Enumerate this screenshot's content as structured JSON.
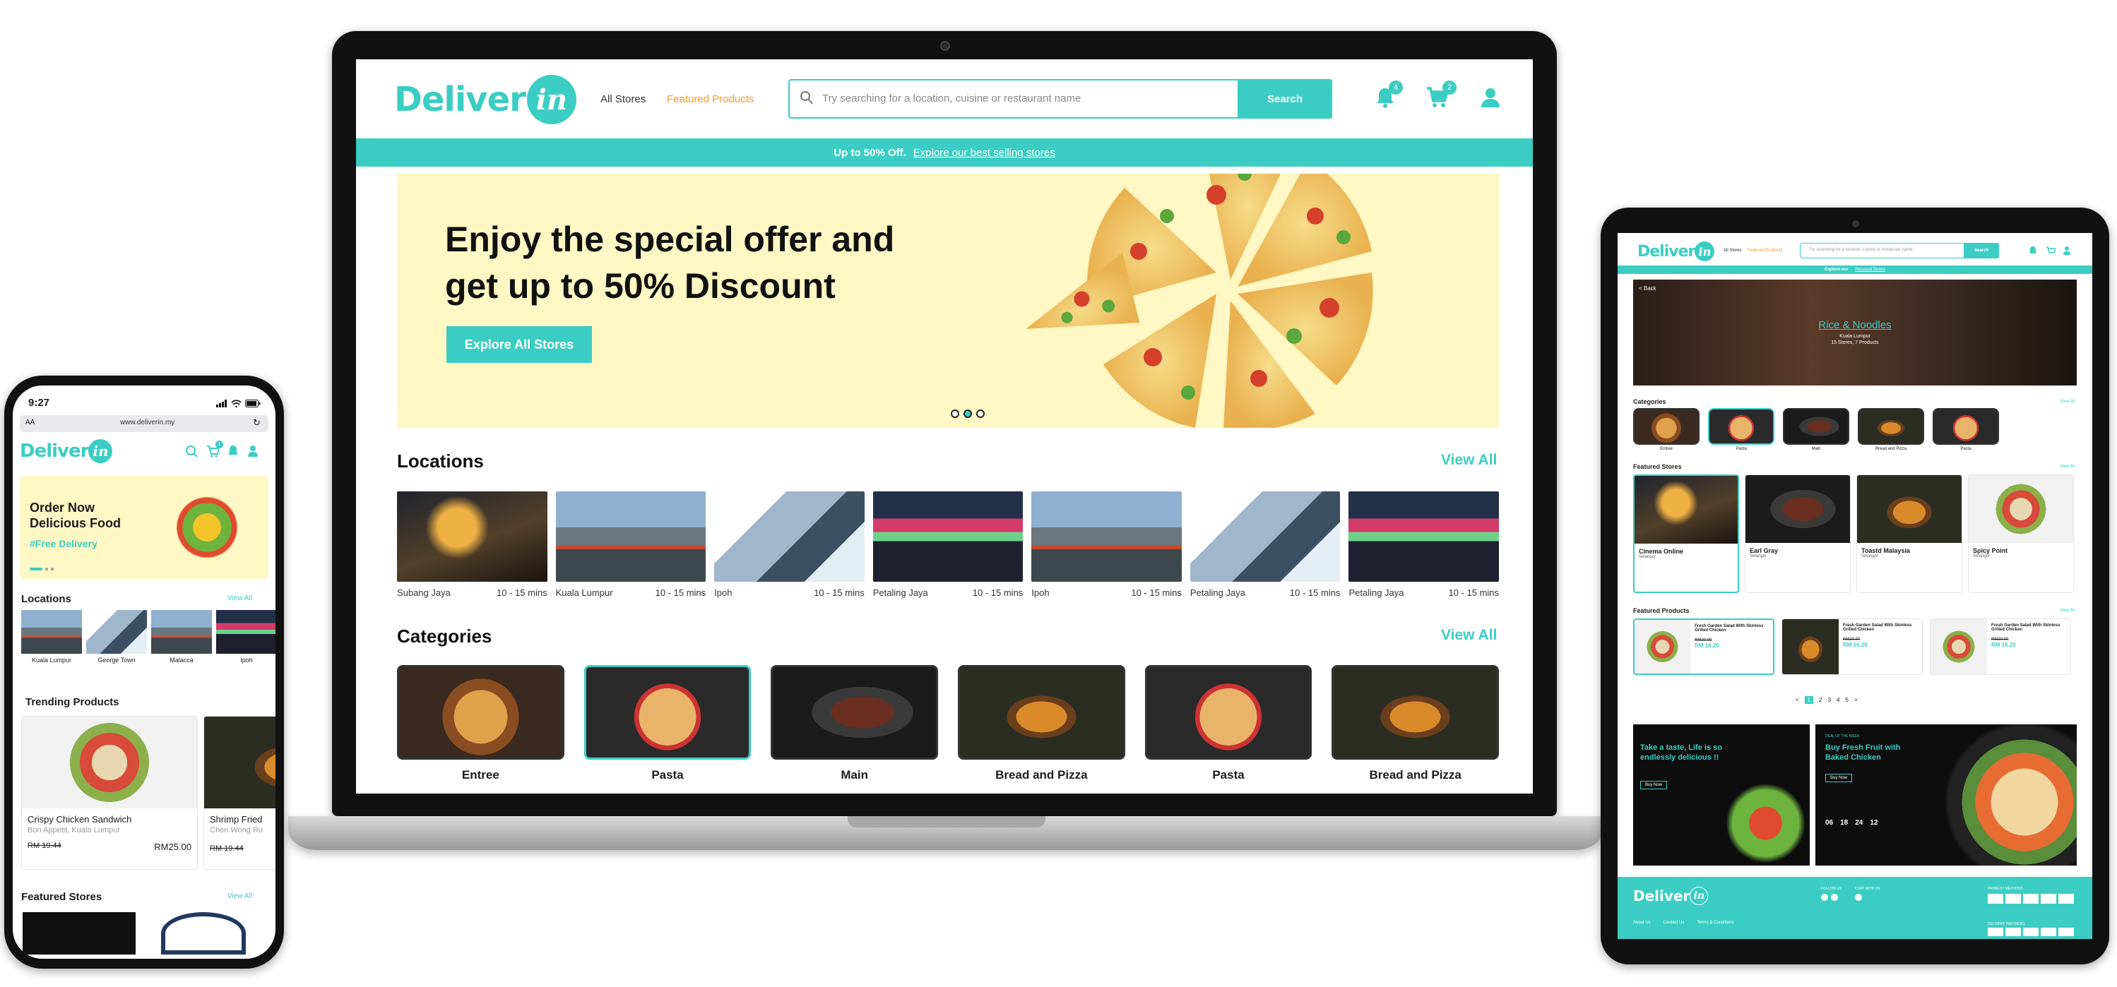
{
  "laptop": {
    "brand": {
      "word": "Deliver",
      "circle": "in"
    },
    "nav": {
      "all_stores": "All Stores",
      "featured_products": "Featured Products"
    },
    "search": {
      "placeholder": "Try searching for a location, cuisine or restaurant name",
      "button": "Search"
    },
    "notifications_count": "4",
    "cart_count": "2",
    "promo": {
      "text": "Up to 50% Off.",
      "link": "Explore our best selling stores"
    },
    "hero": {
      "line1": "Enjoy the special offer and",
      "line2": "get up to 50% Discount",
      "cta": "Explore All Stores"
    },
    "locations": {
      "title": "Locations",
      "view_all": "View All",
      "items": [
        {
          "name": "Subang Jaya",
          "time": "10 - 15 mins"
        },
        {
          "name": "Kuala Lumpur",
          "time": "10 - 15 mins"
        },
        {
          "name": "Ipoh",
          "time": "10 - 15 mins"
        },
        {
          "name": "Petaling Jaya",
          "time": "10 - 15 mins"
        },
        {
          "name": "Ipoh",
          "time": "10 - 15 mins"
        },
        {
          "name": "Petaling Jaya",
          "time": "10 - 15 mins"
        },
        {
          "name": "Petaling Jaya",
          "time": "10 - 15 mins"
        }
      ]
    },
    "categories": {
      "title": "Categories",
      "view_all": "View All",
      "items": [
        "Entree",
        "Pasta",
        "Main",
        "Bread and Pizza",
        "Pasta",
        "Bread and Pizza"
      ]
    }
  },
  "phone": {
    "time": "9:27",
    "url": "www.deliverin.my",
    "aa": "AA",
    "cart_count": "1",
    "hero": {
      "line1": "Order Now",
      "line2": "Delicious Food",
      "tag": "#Free Delivery"
    },
    "locations": {
      "title": "Locations",
      "view_all": "View All",
      "items": [
        "Kuala Lumpur",
        "George Town",
        "Malacca",
        "Ipoh"
      ]
    },
    "trending": {
      "title": "Trending Products",
      "items": [
        {
          "name": "Crispy Chicken Sandwich",
          "store": "Bon Appetit, Kuala Lumpur",
          "old_price": "RM 19.44",
          "price": "RM25.00"
        },
        {
          "name": "Shrimp Fried",
          "store": "Chen Wong Ru",
          "old_price": "RM 19.44",
          "price": ""
        }
      ]
    },
    "featured": {
      "title": "Featured Stores",
      "view_all": "View All"
    }
  },
  "tablet": {
    "nav": {
      "all_stores": "All Stores",
      "featured_products": "Featured Products"
    },
    "search": {
      "placeholder": "Try searching for a location, cuisine or restaurant name",
      "button": "Search"
    },
    "promo": {
      "text": "Explore our",
      "link": "Personal Stores"
    },
    "banner": {
      "back": "< Back",
      "title": "Rice & Noodles",
      "location": "Kuala Lumpur",
      "counts": "15 Stores, 7 Products"
    },
    "categories": {
      "title": "Categories",
      "view_all": "View All",
      "items": [
        "Entree",
        "Pasta",
        "Main",
        "Bread and Pizza",
        "Pasta"
      ]
    },
    "featured_stores": {
      "title": "Featured Stores",
      "view_all": "View All",
      "items": [
        {
          "name": "Cinema Online",
          "state": "Selangor"
        },
        {
          "name": "Earl Gray",
          "state": "Selangor"
        },
        {
          "name": "Toastd Malaysia",
          "state": "Selangor"
        },
        {
          "name": "Spicy Point",
          "state": "Selangor"
        }
      ]
    },
    "featured_products": {
      "title": "Featured Products",
      "view_all": "View All",
      "items": [
        {
          "name": "Fresh Garden Salad With Skinless Grilled Chicken",
          "old_price": "RM20.00",
          "price": "RM 16.20"
        },
        {
          "name": "Fresh Garden Salad With Skinless Grilled Chicken",
          "old_price": "RM20.00",
          "price": "RM 16.20"
        },
        {
          "name": "Fresh Garden Salad With Skinless Grilled Chicken",
          "old_price": "RM20.00",
          "price": "RM 16.20"
        }
      ]
    },
    "pagination": [
      "<",
      "1",
      "2",
      "3",
      "4",
      "5",
      ">"
    ],
    "promo_left": {
      "title": "Take a taste, Life is so endlessly delicious !!",
      "cta": "Buy Now"
    },
    "promo_right": {
      "kicker": "DEAL OF THE WEEK",
      "title": "Buy Fresh Fruit with Baked Chicken",
      "cta": "Buy Now",
      "timer": [
        "06",
        "18",
        "24",
        "12"
      ]
    },
    "footer": {
      "follow_us": "FOLLOW US",
      "chat_with_us": "CHAT WITH US",
      "payment_methods": "PAYMENT METHODS",
      "delivery_partners": "DELIVERY PARTNERS",
      "links": [
        "About Us",
        "Contact Us",
        "Terms & Conditions"
      ]
    }
  }
}
